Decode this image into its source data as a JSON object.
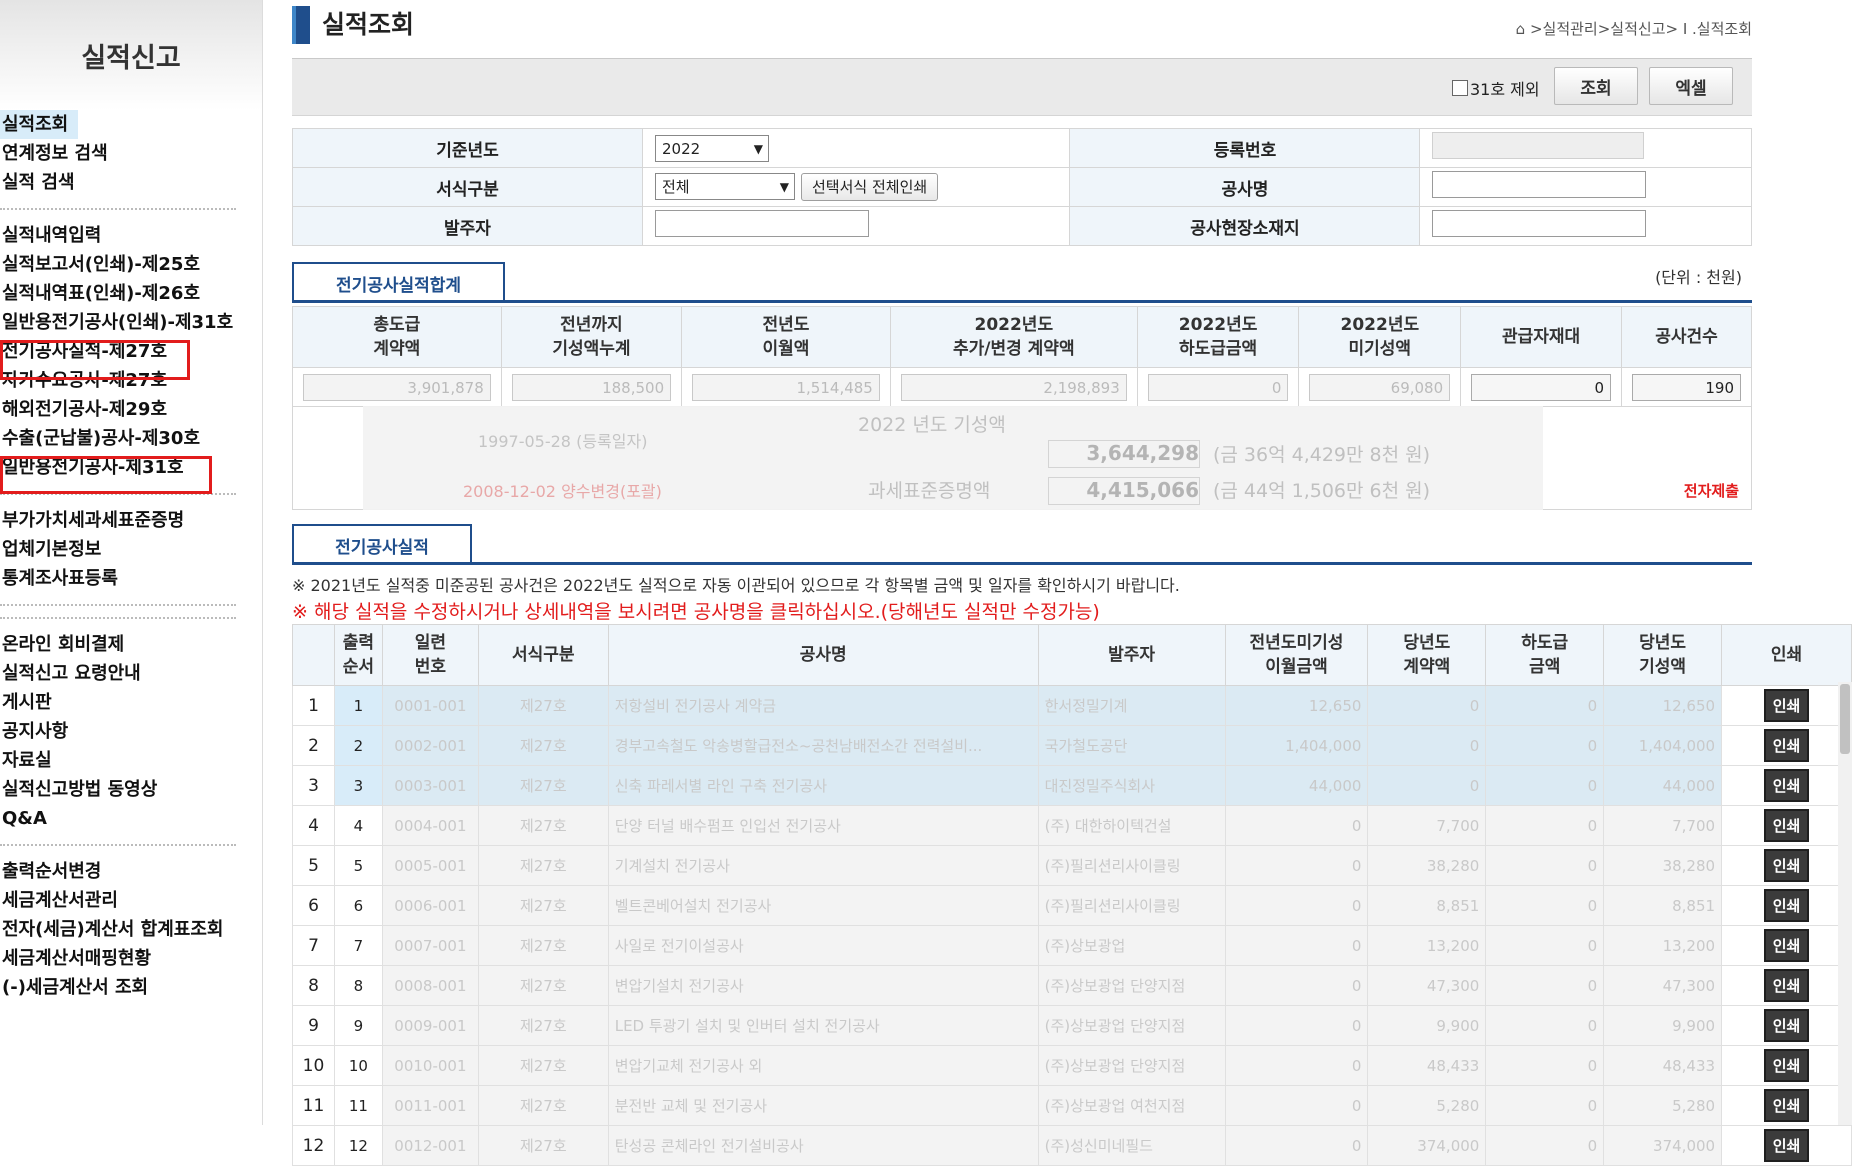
{
  "sidebar": {
    "title": "실적신고",
    "groups": [
      [
        "실적조회",
        "연계정보 검색",
        "실적 검색"
      ],
      [
        "실적내역입력",
        "실적보고서(인쇄)-제25호",
        "실적내역표(인쇄)-제26호",
        "일반용전기공사(인쇄)-제31호",
        "전기공사실적-제27호",
        "자가수요공사-제27호",
        "해외전기공사-제29호",
        "수출(군납불)공사-제30호",
        "일반용전기공사-제31호"
      ],
      [
        "부가가치세과세표준증명",
        "업체기본정보",
        "통계조사표등록"
      ],
      [
        "온라인 회비결제",
        "실적신고 요령안내",
        "게시판",
        "공지사항",
        "자료실",
        "실적신고방법 동영상",
        "Q&A"
      ],
      [
        "출력순서변경",
        "세금계산서관리",
        "전자(세금)계산서 합계표조회",
        "세금계산서매핑현황",
        "(-)세금계산서 조회"
      ]
    ]
  },
  "header": {
    "title": "실적조회",
    "breadcrumb": "⌂ >실적관리>실적신고> I .실적조회"
  },
  "toolbar": {
    "exclude_label": "31호 제외",
    "search_label": "조회",
    "excel_label": "엑셀"
  },
  "search": {
    "year_label": "기준년도",
    "year_value": "2022",
    "reg_label": "등록번호",
    "form_label": "서식구분",
    "form_value": "전체",
    "print_all_label": "선택서식 전체인쇄",
    "project_label": "공사명",
    "client_label": "발주자",
    "site_label": "공사현장소재지"
  },
  "summary": {
    "tab_label": "전기공사실적합계",
    "unit_label": "(단위 : 천원)",
    "headers": [
      "총도급\n계약액",
      "전년까지\n기성액누계",
      "전년도\n이월액",
      "2022년도\n추가/변경 계약액",
      "2022년도\n하도급금액",
      "2022년도\n미기성액",
      "관급자재대",
      "공사건수"
    ],
    "values": [
      "3,901,878",
      "188,500",
      "1,514,485",
      "2,198,893",
      "0",
      "69,080",
      "0",
      "190"
    ],
    "reg_date": "1997-05-28 (등록일자)",
    "kiseong_label": "2022 년도 기성액",
    "kiseong_amount": "3,644,298",
    "kiseong_korean": "(금 36억 4,429만 8천 원)",
    "change_date": "2008-12-02 양수변경(포괄)",
    "tax_label": "과세표준증명액",
    "tax_amount": "4,415,066",
    "tax_korean": "(금 44억 1,506만 6천 원)",
    "e_submit": "전자제출"
  },
  "results": {
    "tab_label": "전기공사실적",
    "notice1": "※ 2021년도 실적중 미준공된 공사건은 2022년도 실적으로 자동 이관되어 있으므로 각 항목별 금액 및 일자를 확인하시기 바랍니다.",
    "notice2": "※ 해당 실적을 수정하시거나 상세내역을 보시려면 공사명을 클릭하십시오.(당해년도 실적만 수정가능)",
    "headers": [
      "",
      "출력\n순서",
      "일련\n번호",
      "서식구분",
      "공사명",
      "발주자",
      "전년도미기성\n이월금액",
      "당년도\n계약액",
      "하도급\n금액",
      "당년도\n기성액",
      "인쇄"
    ],
    "print_label": "인쇄",
    "rows": [
      {
        "no": "1",
        "order": "1",
        "serial": "0001-001",
        "form": "제27호",
        "name": "저항설비 전기공사 계약금",
        "client": "한서정밀기계",
        "carry": "12,650",
        "contract": "0",
        "sub": "0",
        "done": "12,650"
      },
      {
        "no": "2",
        "order": "2",
        "serial": "0002-001",
        "form": "제27호",
        "name": "경부고속철도 악송병할급전소~공천남배전소간 전력설비...",
        "client": "국가철도공단",
        "carry": "1,404,000",
        "contract": "0",
        "sub": "0",
        "done": "1,404,000"
      },
      {
        "no": "3",
        "order": "3",
        "serial": "0003-001",
        "form": "제27호",
        "name": "신축 파레서별 라인 구축 전기공사",
        "client": "대진정밀주식회사",
        "carry": "44,000",
        "contract": "0",
        "sub": "0",
        "done": "44,000"
      },
      {
        "no": "4",
        "order": "4",
        "serial": "0004-001",
        "form": "제27호",
        "name": "단양 터널 배수펌프 인입선 전기공사",
        "client": "(주) 대한하이텍건설",
        "carry": "0",
        "contract": "7,700",
        "sub": "0",
        "done": "7,700"
      },
      {
        "no": "5",
        "order": "5",
        "serial": "0005-001",
        "form": "제27호",
        "name": "기계설치 전기공사",
        "client": "(주)필리션리사이클링",
        "carry": "0",
        "contract": "38,280",
        "sub": "0",
        "done": "38,280"
      },
      {
        "no": "6",
        "order": "6",
        "serial": "0006-001",
        "form": "제27호",
        "name": "벨트콘베어설치 전기공사",
        "client": "(주)필리션리사이클링",
        "carry": "0",
        "contract": "8,851",
        "sub": "0",
        "done": "8,851"
      },
      {
        "no": "7",
        "order": "7",
        "serial": "0007-001",
        "form": "제27호",
        "name": "사일로 전기이설공사",
        "client": "(주)상보광업",
        "carry": "0",
        "contract": "13,200",
        "sub": "0",
        "done": "13,200"
      },
      {
        "no": "8",
        "order": "8",
        "serial": "0008-001",
        "form": "제27호",
        "name": "변압기설치 전기공사",
        "client": "(주)상보광업 단양지점",
        "carry": "0",
        "contract": "47,300",
        "sub": "0",
        "done": "47,300"
      },
      {
        "no": "9",
        "order": "9",
        "serial": "0009-001",
        "form": "제27호",
        "name": "LED 투광기 설치 및 인버터 설치 전기공사",
        "client": "(주)상보광업 단양지점",
        "carry": "0",
        "contract": "9,900",
        "sub": "0",
        "done": "9,900"
      },
      {
        "no": "10",
        "order": "10",
        "serial": "0010-001",
        "form": "제27호",
        "name": "변압기교체 전기공사 외",
        "client": "(주)상보광업 단양지점",
        "carry": "0",
        "contract": "48,433",
        "sub": "0",
        "done": "48,433"
      },
      {
        "no": "11",
        "order": "11",
        "serial": "0011-001",
        "form": "제27호",
        "name": "분전반 교체 및 전기공사",
        "client": "(주)상보광업 여천지점",
        "carry": "0",
        "contract": "5,280",
        "sub": "0",
        "done": "5,280"
      },
      {
        "no": "12",
        "order": "12",
        "serial": "0012-001",
        "form": "제27호",
        "name": "탄성공 콘체라인 전기설비공사",
        "client": "(주)성신미네필드",
        "carry": "0",
        "contract": "374,000",
        "sub": "0",
        "done": "374,000"
      }
    ]
  },
  "colors": {
    "accent": "#1f4e8c",
    "highlight_box": "#e21c1c",
    "notice_red": "#e21c1c",
    "header_bg": "#eff5fa"
  }
}
